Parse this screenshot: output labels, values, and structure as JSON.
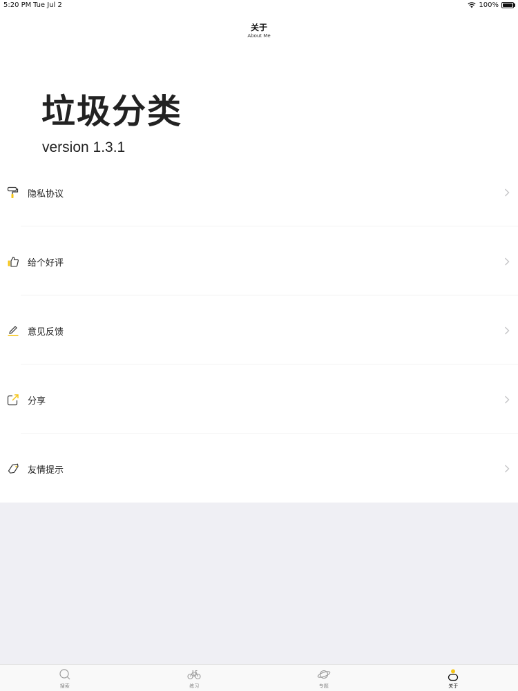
{
  "status_bar": {
    "time": "5:20 PM",
    "date": "Tue Jul 2",
    "battery": "100%",
    "battery_level": 1.0
  },
  "navbar": {
    "title": "关于",
    "subtitle": "About Me"
  },
  "header": {
    "app_title": "垃圾分类",
    "version": "version 1.3.1"
  },
  "menu": {
    "items": [
      {
        "label": "隐私协议",
        "icon": "paint-roller-icon"
      },
      {
        "label": "给个好评",
        "icon": "thumbs-up-icon"
      },
      {
        "label": "意见反馈",
        "icon": "pencil-icon"
      },
      {
        "label": "分享",
        "icon": "share-icon"
      },
      {
        "label": "友情提示",
        "icon": "tag-icon"
      }
    ]
  },
  "tabbar": {
    "tabs": [
      {
        "label": "搜索",
        "icon": "search-icon",
        "active": false
      },
      {
        "label": "练习",
        "icon": "bicycle-icon",
        "active": false
      },
      {
        "label": "专题",
        "icon": "planet-icon",
        "active": false
      },
      {
        "label": "关于",
        "icon": "person-icon",
        "active": true
      }
    ]
  },
  "colors": {
    "accent": "#f5c518",
    "background": "#efeff4",
    "surface": "#ffffff",
    "text": "#222222"
  }
}
